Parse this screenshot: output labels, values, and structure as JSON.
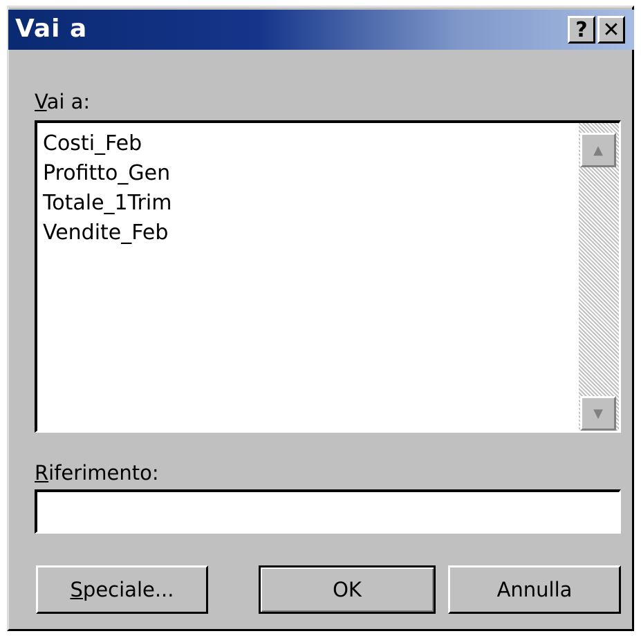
{
  "window": {
    "title": "Vai a"
  },
  "title_buttons": {
    "help": "?",
    "close": "✕"
  },
  "goto": {
    "label_accel": "V",
    "label_rest": "ai a:",
    "items": [
      "Costi_Feb",
      "Profitto_Gen",
      "Totale_1Trim",
      "Vendite_Feb"
    ]
  },
  "scroll": {
    "up": "▲",
    "down": "▼"
  },
  "reference": {
    "label_accel": "R",
    "label_rest": "iferimento:",
    "value": ""
  },
  "buttons": {
    "special_accel": "S",
    "special_rest": "peciale...",
    "ok": "OK",
    "cancel": "Annulla"
  }
}
